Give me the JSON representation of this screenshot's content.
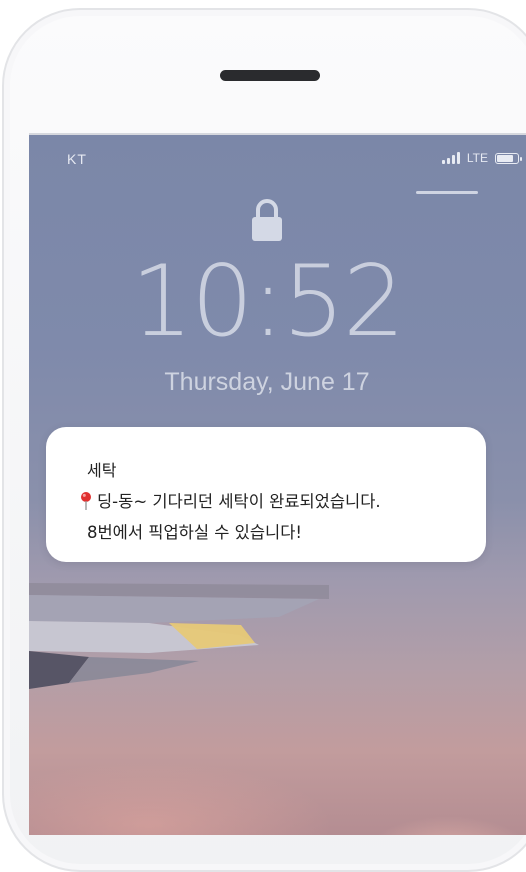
{
  "status_bar": {
    "carrier": "KT",
    "network": "LTE",
    "signal_icon": "signal-bars-icon",
    "battery_icon": "battery-icon"
  },
  "lock_screen": {
    "lock_icon": "lock-icon",
    "time": "10:52",
    "date": "Thursday, June 17"
  },
  "notification": {
    "app_title": "세탁",
    "pin_icon": "pushpin-icon",
    "line1": "딩-동~ 기다리던 세탁이 완료되었습니다.",
    "line2": "8번에서 픽업하실 수 있습니다!"
  },
  "colors": {
    "screen_top": "#7b87a8",
    "screen_bottom": "#b48d92",
    "notification_bg": "#ffffff",
    "pin_red": "#e0302f"
  }
}
